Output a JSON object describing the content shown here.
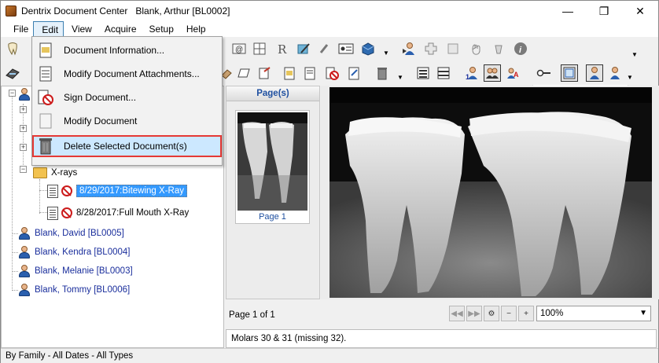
{
  "window": {
    "title": "Dentrix Document Center   Blank, Arthur [BL0002]",
    "minimize": "—",
    "maximize": "❐",
    "close": "✕"
  },
  "menu": [
    "File",
    "Edit",
    "View",
    "Acquire",
    "Setup",
    "Help"
  ],
  "edit_menu": {
    "items": [
      {
        "label": "Document Information...",
        "icon": "document-info-icon"
      },
      {
        "label": "Modify Document Attachments...",
        "icon": "document-attach-icon"
      },
      {
        "label": "Sign Document...",
        "icon": "sign-document-icon"
      },
      {
        "label": "Modify Document",
        "icon": "modify-document-icon"
      },
      {
        "label": "Delete Selected Document(s)",
        "icon": "trash-can-icon"
      }
    ],
    "highlighted_index": 4,
    "highlight_color": "#e53935"
  },
  "tree": {
    "folder_label": "X-rays",
    "documents": [
      "8/29/2017:Bitewing X-Ray",
      "8/28/2017:Full Mouth X-Ray"
    ],
    "selected_index": 0,
    "patients": [
      "Blank, David [BL0005]",
      "Blank, Kendra [BL0004]",
      "Blank, Melanie [BL0003]",
      "Blank, Tommy [BL0006]"
    ]
  },
  "pages_panel": {
    "header": "Page(s)",
    "thumb_label": "Page 1"
  },
  "viewer": {
    "page_count": "Page 1 of 1",
    "zoom": "100%"
  },
  "notes": "Molars 30 & 31 (missing 32).",
  "statusbar": "By Family - All Dates - All Types",
  "colors": {
    "link": "#1a2e9c",
    "selection": "#3399ff",
    "pages_header": "#1e4fa0"
  }
}
